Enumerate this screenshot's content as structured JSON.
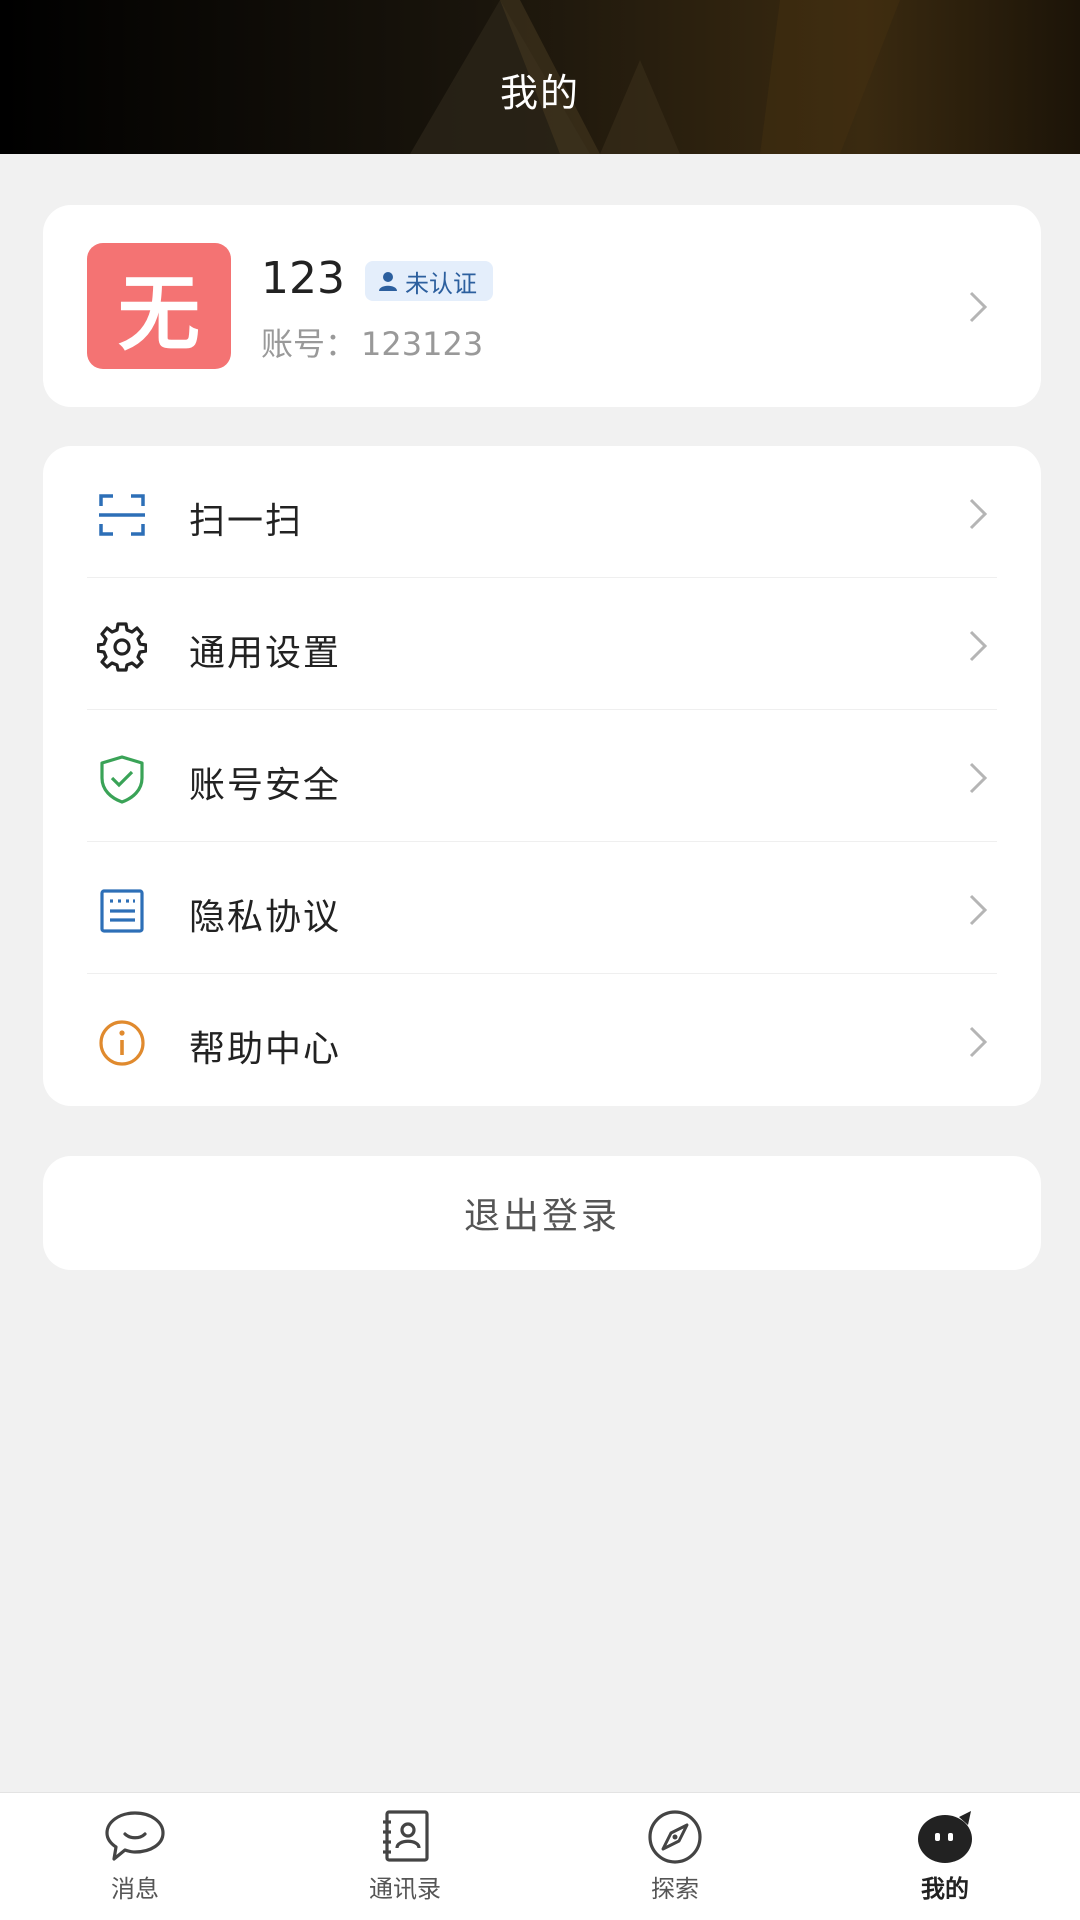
{
  "header": {
    "title": "我的"
  },
  "profile": {
    "avatar_text": "无",
    "name": "123",
    "badge": "未认证",
    "account_label": "账号：",
    "account_value": "123123"
  },
  "menu": {
    "items": [
      {
        "label": "扫一扫",
        "icon": "scan-icon"
      },
      {
        "label": "通用设置",
        "icon": "gear-icon"
      },
      {
        "label": "账号安全",
        "icon": "shield-check-icon"
      },
      {
        "label": "隐私协议",
        "icon": "document-icon"
      },
      {
        "label": "帮助中心",
        "icon": "info-icon"
      }
    ]
  },
  "logout": {
    "label": "退出登录"
  },
  "bottom_nav": {
    "items": [
      {
        "label": "消息",
        "icon": "chat-bubble-icon"
      },
      {
        "label": "通讯录",
        "icon": "contacts-book-icon"
      },
      {
        "label": "探索",
        "icon": "compass-icon"
      },
      {
        "label": "我的",
        "icon": "profile-face-icon",
        "active": true
      }
    ]
  },
  "colors": {
    "avatar_bg": "#f47373",
    "badge_bg": "#e4eefb",
    "badge_text": "#2c5f9e",
    "scan_icon": "#2d6fb7",
    "shield_icon": "#3aa357",
    "document_icon": "#2d6fb7",
    "info_icon": "#e08a2e"
  }
}
